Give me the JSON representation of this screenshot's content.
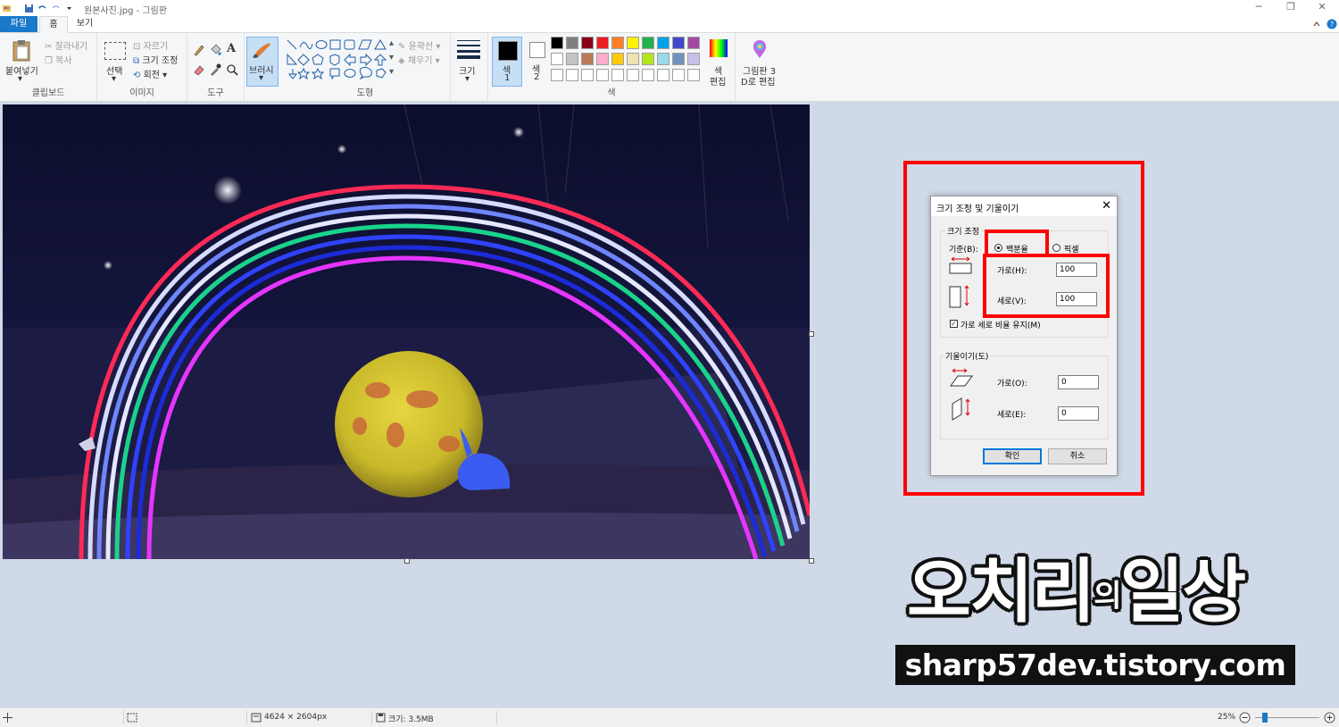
{
  "window": {
    "title": "원본사진.jpg - 그림판",
    "controls": {
      "minimize": "─",
      "restore": "❐",
      "close": "✕"
    }
  },
  "menu_tabs": {
    "file": "파일",
    "home": "홈",
    "view": "보기"
  },
  "ribbon": {
    "clipboard": {
      "paste": "붙여넣기",
      "cut": "잘라내기",
      "copy": "복사",
      "group": "클립보드"
    },
    "image": {
      "select": "선택",
      "crop": "자르기",
      "resize": "크기 조정",
      "rotate": "회전",
      "group": "이미지"
    },
    "tools": {
      "group": "도구"
    },
    "brushes": {
      "label": "브러시"
    },
    "shapes": {
      "outline": "윤곽선",
      "fill": "채우기",
      "group": "도형"
    },
    "size": {
      "label": "크기"
    },
    "colors": {
      "color1": "색 1",
      "color1_a": "색",
      "color1_b": "1",
      "color2_a": "색",
      "color2_b": "2",
      "edit_a": "색",
      "edit_b": "편집",
      "group": "색",
      "palette_row1": [
        "#000000",
        "#7f7f7f",
        "#880015",
        "#ed1c24",
        "#ff7f27",
        "#fff200",
        "#22b14c",
        "#00a2e8",
        "#3f48cc",
        "#a349a4"
      ],
      "palette_row2": [
        "#ffffff",
        "#c3c3c3",
        "#b97a57",
        "#ffaec9",
        "#ffc90e",
        "#efe4b0",
        "#b5e61d",
        "#99d9ea",
        "#7092be",
        "#c8bfe7"
      ]
    },
    "paint3d": {
      "a": "그림판 3",
      "b": "D로 편집"
    }
  },
  "dialog": {
    "title": "크기 조정 및 기울이기",
    "resize_legend": "크기 조정",
    "basis_label": "기준(B):",
    "percent_label": "백분율",
    "pixel_label": "픽셀",
    "selected_basis": "percent",
    "horizontal_label": "가로(H):",
    "horizontal_value": "100",
    "vertical_label": "세로(V):",
    "vertical_value": "100",
    "keep_ratio_label": "가로 세로 비율 유지(M)",
    "keep_ratio_checked": true,
    "skew_legend": "기울이기(도)",
    "skew_h_label": "가로(O):",
    "skew_h_value": "0",
    "skew_v_label": "세로(E):",
    "skew_v_value": "0",
    "ok": "확인",
    "cancel": "취소"
  },
  "watermark": {
    "name_a": "오치리",
    "name_small": "의",
    "name_b": "일상",
    "url": "sharp57dev.tistory.com"
  },
  "status": {
    "dimensions": "4624 × 2604px",
    "size": "크기: 3.5MB",
    "zoom": "25%",
    "zoom_level": 0.25
  }
}
